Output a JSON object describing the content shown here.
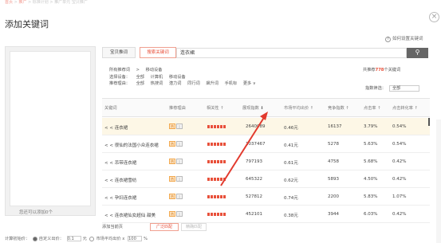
{
  "breadcrumb": [
    "首页",
    "推广",
    "标准计划",
    "",
    "推广单元",
    "宝贝推广"
  ],
  "dialog": {
    "title": "添加关键词",
    "close": "×",
    "help": "如何设置关键词"
  },
  "left_panel": {
    "footer": "您还可以添加0个"
  },
  "tabs": [
    "宝贝推词",
    "搜索关键词"
  ],
  "search": {
    "value": "连衣裙",
    "button": "⚲"
  },
  "filters": {
    "row1": [
      "所有推荐词",
      ">",
      "移动设备"
    ],
    "row2": [
      "选择设备：",
      "全部",
      "计算机",
      "移动设备"
    ],
    "row3": [
      "推荐理由：",
      "全部",
      "热搜词",
      "潜力词",
      "同行词",
      "飙升词",
      "手机标",
      "更多 ∨"
    ]
  },
  "count": {
    "prefix": "共推荐",
    "value": "778",
    "suffix": "个关键词"
  },
  "metric_filter": {
    "label": "指数筛选：",
    "value": "全部"
  },
  "columns": [
    "关键词",
    "推荐理由",
    "相关性 ↑",
    "展现指数 ⬇",
    "市场平均出价 ↑",
    "竞争指数 ↑",
    "点击率 ↑",
    "点击转化率 ↑"
  ],
  "rows": [
    {
      "keyword": "< < 连衣裙",
      "impressions": "2640089",
      "avg_bid": "0.46元",
      "competition": "16137",
      "ctr": "3.79%",
      "cvr": "0.54%"
    },
    {
      "keyword": "< < 很仙的法国小众连衣裙",
      "impressions": "1037467",
      "avg_bid": "0.41元",
      "competition": "5278",
      "ctr": "5.63%",
      "cvr": "0.54%"
    },
    {
      "keyword": "< < 吊带连衣裙",
      "impressions": "797193",
      "avg_bid": "0.61元",
      "competition": "4758",
      "ctr": "5.68%",
      "cvr": "0.42%"
    },
    {
      "keyword": "< < 连衣裙雪纺",
      "impressions": "645322",
      "avg_bid": "0.62元",
      "competition": "5893",
      "ctr": "4.50%",
      "cvr": "0.42%"
    },
    {
      "keyword": "< < 孕妇连衣裙",
      "impressions": "527812",
      "avg_bid": "0.74元",
      "competition": "2200",
      "ctr": "5.83%",
      "cvr": "1.07%"
    },
    {
      "keyword": "< < 连衣裙仙女超仙 甜美",
      "impressions": "452101",
      "avg_bid": "0.38元",
      "competition": "3944",
      "ctr": "6.03%",
      "cvr": "0.42%"
    }
  ],
  "bottom": {
    "label": "添加当前页",
    "btn1": "广泛匹配",
    "btn2": "精确匹配"
  },
  "price": {
    "label": "计算初始价：",
    "opt1": "自定义出价：",
    "value": "0.1",
    "unit": "元",
    "opt2": "市场平均出价",
    "x": "x",
    "pct": "100",
    "pct_unit": "%"
  },
  "colors": {
    "accent": "#e8503a",
    "tag": "#f2a84d"
  }
}
